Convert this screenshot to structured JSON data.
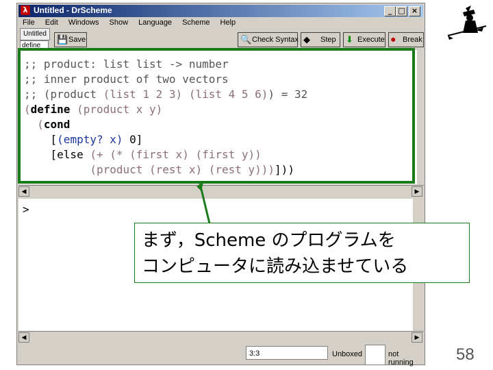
{
  "window": {
    "title": "Untitled - DrScheme",
    "app_icon": "λ",
    "controls": {
      "minimize": "_",
      "maximize": "□",
      "close": "×"
    }
  },
  "menu": [
    "File",
    "Edit",
    "Windows",
    "Show",
    "Language",
    "Scheme",
    "Help"
  ],
  "file_tab": "Untitled",
  "define_popup": "define ...",
  "toolbar": {
    "save": "Save",
    "check_syntax": "Check Syntax",
    "step": "Step",
    "execute": "Execute",
    "break": "Break"
  },
  "code_lines": [
    [
      {
        "t": ";; product: list list -> number",
        "c": "g"
      }
    ],
    [
      {
        "t": ";; inner product of two vectors",
        "c": "g"
      }
    ],
    [
      {
        "t": ";; (product ",
        "c": "g"
      },
      {
        "t": "(list 1 2 3) (list 4 5 6)",
        "c": "p"
      },
      {
        "t": ") = 32",
        "c": "g"
      }
    ],
    [
      {
        "t": "(",
        "c": "p"
      },
      {
        "t": "define",
        "c": "k"
      },
      {
        "t": " ",
        "c": ""
      },
      {
        "t": "(product x y)",
        "c": "p"
      }
    ],
    [
      {
        "t": "  (",
        "c": "p"
      },
      {
        "t": "cond",
        "c": "k"
      }
    ],
    [
      {
        "t": "    [",
        "c": ""
      },
      {
        "t": "(empty? x)",
        "c": "b"
      },
      {
        "t": " 0]",
        "c": ""
      }
    ],
    [
      {
        "t": "    [else ",
        "c": ""
      },
      {
        "t": "(+ (* (first x) (first y))",
        "c": "p"
      }
    ],
    [
      {
        "t": "          ",
        "c": ""
      },
      {
        "t": "(product (rest x) (rest y)))",
        "c": "p"
      },
      {
        "t": "]))",
        "c": ""
      }
    ]
  ],
  "interactions": {
    "prompt": ">"
  },
  "status": {
    "position": "3:3",
    "unboxed": "Unboxed",
    "running": "not running"
  },
  "annotation": {
    "lines": [
      "まず，Scheme のプログラムを",
      "コンピュータに読み込ませている"
    ]
  },
  "page_number": "58",
  "colors": {
    "highlight_frame": "#1a7b1a",
    "titlebar": "#0a246a",
    "paren_text": "#8a6f7a",
    "keyword_text": "#1a34a0"
  }
}
